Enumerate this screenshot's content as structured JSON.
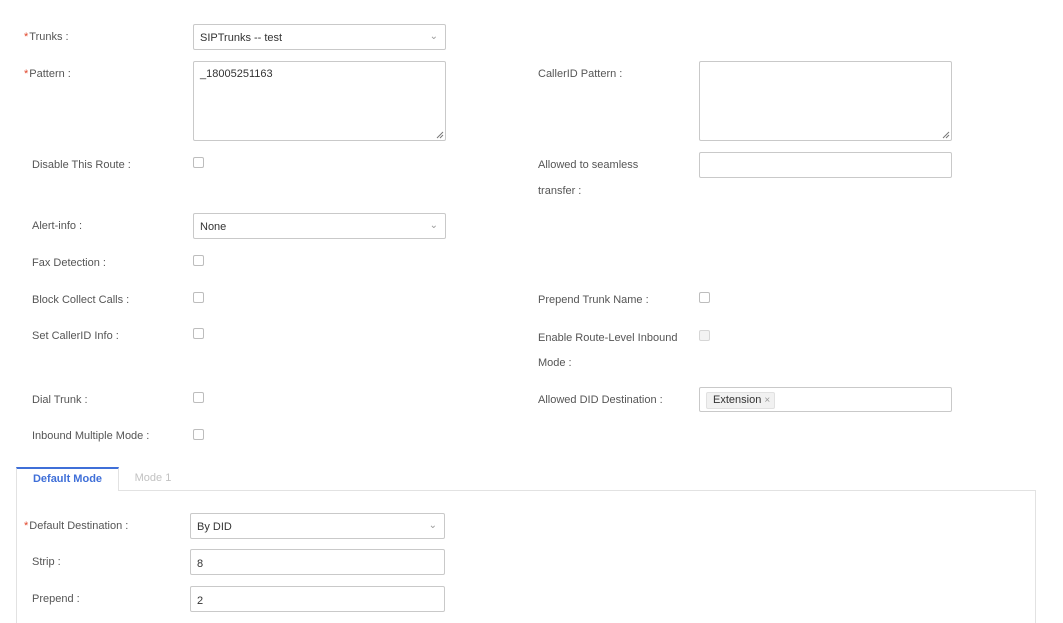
{
  "colors": {
    "required": "#e0452a",
    "accent": "#3f6fd8"
  },
  "icons": {
    "dropdown": "chevron-down-icon",
    "resize": "resize-grip-icon",
    "remove_tag": "close-icon"
  },
  "fields": {
    "trunks": {
      "label": "Trunks",
      "value": "SIPTrunks -- test"
    },
    "pattern": {
      "label": "Pattern",
      "value": "_18005251163"
    },
    "callerid_pattern": {
      "label": "CallerID Pattern",
      "value": ""
    },
    "disable_route": {
      "label": "Disable This Route",
      "checked": false
    },
    "seamless_transfer": {
      "label_line1": "Allowed to seamless",
      "label_line2": "transfer",
      "value": ""
    },
    "alert_info": {
      "label": "Alert-info",
      "value": "None"
    },
    "fax_detection": {
      "label": "Fax Detection",
      "checked": false
    },
    "block_collect_calls": {
      "label": "Block Collect Calls",
      "checked": false
    },
    "prepend_trunk_name": {
      "label": "Prepend Trunk Name",
      "checked": false
    },
    "set_callerid_info": {
      "label": "Set CallerID Info",
      "checked": false
    },
    "route_level_inbound": {
      "label_line1": "Enable Route-Level Inbound",
      "label_line2": "Mode",
      "checked": false,
      "disabled": true
    },
    "dial_trunk": {
      "label": "Dial Trunk",
      "checked": false
    },
    "allowed_did_destination": {
      "label": "Allowed DID Destination",
      "tags": [
        "Extension"
      ]
    },
    "inbound_multiple_mode": {
      "label": "Inbound Multiple Mode",
      "checked": false
    }
  },
  "tabs": [
    {
      "label": "Default Mode",
      "active": true
    },
    {
      "label": "Mode 1",
      "active": false
    }
  ],
  "mode_panel": {
    "default_destination": {
      "label": "Default Destination",
      "value": "By DID"
    },
    "strip": {
      "label": "Strip",
      "value": "8"
    },
    "prepend": {
      "label": "Prepend",
      "value": "2"
    }
  }
}
